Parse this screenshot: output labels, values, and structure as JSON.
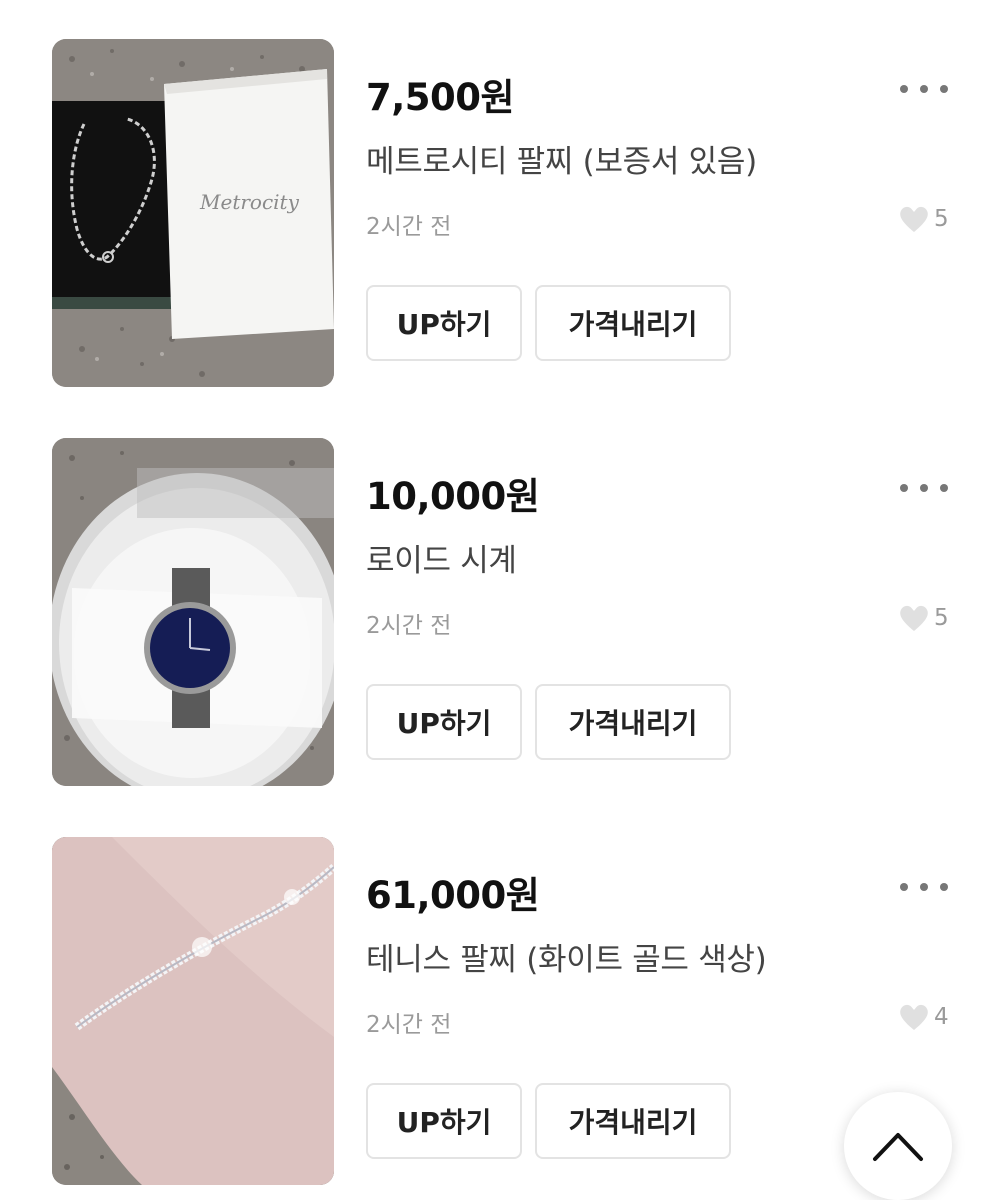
{
  "items": [
    {
      "price": "7,500원",
      "title": "메트로시티 팔찌 (보증서 있음)",
      "time": "2시간 전",
      "likes": "5",
      "up_label": "UP하기",
      "price_down_label": "가격내리기",
      "thumb_text": "Metrocity"
    },
    {
      "price": "10,000원",
      "title": "로이드 시계",
      "time": "2시간 전",
      "likes": "5",
      "up_label": "UP하기",
      "price_down_label": "가격내리기"
    },
    {
      "price": "61,000원",
      "title": "테니스 팔찌 (화이트 골드 색상)",
      "time": "2시간 전",
      "likes": "4",
      "up_label": "UP하기",
      "price_down_label": "가격내리기"
    }
  ],
  "icons": {
    "more": "more-horizontal-icon",
    "like": "heart-icon",
    "scroll_top": "chevron-up-icon"
  },
  "colors": {
    "background": "#ffffff",
    "price": "#111111",
    "title": "#444444",
    "meta": "#9a9a9a",
    "button_border": "#e3e3e3",
    "heart": "#e0e0e0"
  }
}
